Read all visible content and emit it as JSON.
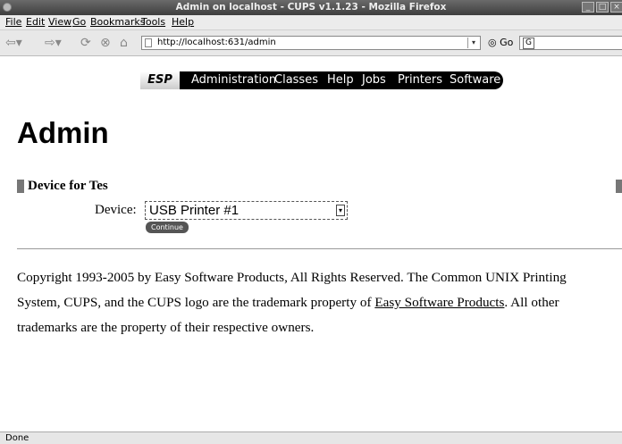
{
  "window": {
    "title": "Admin on localhost - CUPS v1.1.23 - Mozilla Firefox"
  },
  "menu": [
    "File",
    "Edit",
    "View",
    "Go",
    "Bookmarks",
    "Tools",
    "Help"
  ],
  "nav": {
    "url": "http://localhost:631/admin",
    "go_label": "Go",
    "search_engine": "G"
  },
  "cups_nav": {
    "logo": "ESP",
    "items": [
      "Administration",
      "Classes",
      "Help",
      "Jobs",
      "Printers",
      "Software"
    ]
  },
  "page": {
    "heading": "Admin",
    "section_title": "Device for Tes",
    "device_label": "Device:",
    "device_selected": "USB Printer #1",
    "continue_label": "Continue",
    "copyright_1": "Copyright 1993-2005 by Easy Software Products, All Rights Reserved. The Common UNIX Printing",
    "copyright_2a": "System, CUPS, and the CUPS logo are the trademark property of ",
    "copyright_link": "Easy Software Products",
    "copyright_2b": ". All other",
    "copyright_3": "trademarks are the property of their respective owners."
  },
  "status": "Done"
}
